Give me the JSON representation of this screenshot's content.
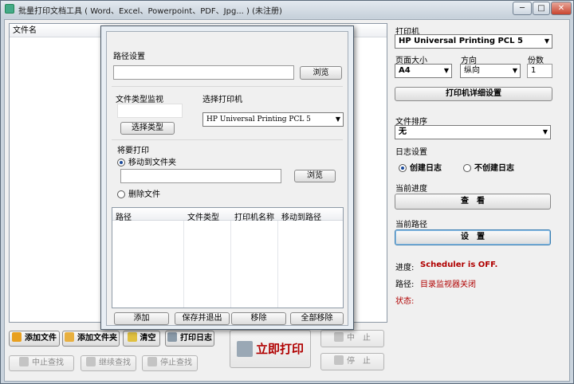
{
  "window": {
    "title": "批量打印文档工具 ( Word、Excel、Powerpoint、PDF、Jpg... ) (未注册)",
    "min_symbol": "─",
    "max_symbol": "□",
    "close_symbol": "✕"
  },
  "file_list": {
    "column_header": "文件名"
  },
  "bottom_toolbar": {
    "add_file": "添加文件",
    "add_folder": "添加文件夹",
    "clear": "清空",
    "print_log": "打印日志",
    "stop_search": "中止查找",
    "continue_search": "继续查找",
    "pause_search": "停止查找",
    "print_now": "立即打印",
    "abort": "中　止",
    "stop": "停　止"
  },
  "right_panel": {
    "printer_label": "打印机",
    "printer_value": "HP Universal Printing PCL 5",
    "page_size_label": "页面大小",
    "page_size_value": "A4",
    "orientation_label": "方向",
    "orientation_value": "纵向",
    "copies_label": "份数",
    "copies_value": "1",
    "printer_details_button": "打印机详细设置",
    "file_sort_label": "文件排序",
    "file_sort_value": "无",
    "log_settings_label": "日志设置",
    "create_log": "创建日志",
    "no_log": "不创建日志",
    "current_progress_label": "当前进度",
    "view_button": "查　看",
    "current_path_label": "当前路径",
    "settings_button": "设　置",
    "progress_key": "进度:",
    "progress_value": "Scheduler is OFF.",
    "path_key": "路径:",
    "path_value": "目录监视器关闭",
    "status_key": "状态:"
  },
  "dialog": {
    "path_settings_label": "路径设置",
    "path_value": "",
    "browse_button": "浏览",
    "file_type_monitor_label": "文件类型监视",
    "file_type_value": "",
    "select_type_button": "选择类型",
    "select_printer_label": "选择打印机",
    "printer_value": "HP Universal Printing PCL 5",
    "after_print_label": "将要打印",
    "move_to_folder": "移动到文件夹",
    "move_path_value": "",
    "browse_button_2": "浏览",
    "delete_file": "删除文件",
    "grid_headers": [
      "路径",
      "文件类型",
      "打印机名称",
      "移动到路径"
    ],
    "add_button": "添加",
    "save_exit_button": "保存并退出",
    "remove_button": "移除",
    "remove_all_button": "全部移除"
  },
  "colors": {
    "accent_red": "#b00000",
    "window_frame": "#c9d3dd"
  }
}
